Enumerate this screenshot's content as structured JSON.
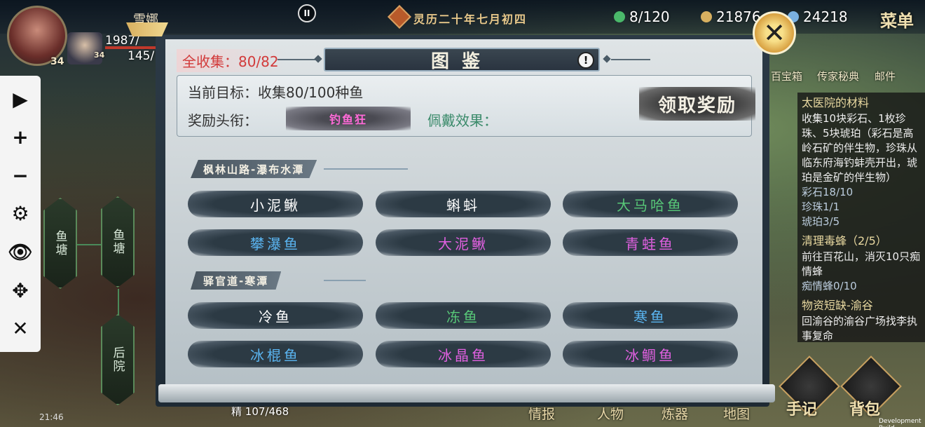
{
  "hud": {
    "player_name": "雪娜",
    "hp_text": "1987/",
    "mp_text": "145/",
    "level_main": "34",
    "level_companion": "34",
    "date": "灵历二十年七月初四",
    "res_1": "8/120",
    "res_2": "21876",
    "res_3": "24218",
    "menu_label": "菜单",
    "pause_glyph": "II",
    "exp_text": "107/468",
    "exp_label": "精",
    "clock": "21:46",
    "dev_build": "Development Build"
  },
  "toolbar": {
    "play": "▶",
    "zoom_in": "+",
    "zoom_out": "−",
    "settings": "⚙",
    "view": "👁",
    "move": "✥",
    "close": "✕"
  },
  "map": {
    "node_1": "鱼塘",
    "node_2": "鱼塘",
    "node_3": "后院"
  },
  "top_icons": {
    "item_1": "百宝箱",
    "item_2": "传家秘典",
    "item_3": "邮件"
  },
  "quests": [
    {
      "title": "太医院的材料",
      "body": "收集10块彩石、1枚珍珠、5块琥珀（彩石是高岭石矿的伴生物，珍珠从临东府海钓蚌壳开出，琥珀是金矿的伴生物）",
      "progress": [
        "彩石18/10",
        "珍珠1/1",
        "琥珀3/5"
      ]
    },
    {
      "title": "清理毒蜂（2/5）",
      "body": "前往百花山，消灭10只痴情蜂",
      "progress": [
        "痴情蜂0/10"
      ]
    },
    {
      "title": "物资短缺-渝谷",
      "body": "回渝谷的渝谷广场找李执事复命",
      "progress": []
    }
  ],
  "bottom_nav": {
    "item_1": "情报",
    "item_2": "人物",
    "item_3": "炼器",
    "item_4": "地图"
  },
  "corner_buttons": {
    "notes": "手记",
    "bag": "背包"
  },
  "modal": {
    "title": "图鉴",
    "info_glyph": "!",
    "collect_total": "全收集：80/82",
    "target": "当前目标：收集80/100种鱼",
    "reward_title_label": "奖励头衔：",
    "reward_title": "钓鱼狂",
    "effect_label": "佩戴效果：",
    "claim": "领取奖励",
    "close_glyph": "✕",
    "sections": [
      {
        "name": "枫林山路-瀑布水潭",
        "fish": [
          {
            "name": "小泥鳅",
            "color": "#ffffff"
          },
          {
            "name": "蝌蚪",
            "color": "#ffffff"
          },
          {
            "name": "大马哈鱼",
            "color": "#58c878"
          },
          {
            "name": "攀瀑鱼",
            "color": "#5ab4f0"
          },
          {
            "name": "大泥鳅",
            "color": "#e060e0"
          },
          {
            "name": "青蛙鱼",
            "color": "#e060e0"
          }
        ]
      },
      {
        "name": "驿官道-寒潭",
        "fish": [
          {
            "name": "冷鱼",
            "color": "#ffffff"
          },
          {
            "name": "冻鱼",
            "color": "#58c878"
          },
          {
            "name": "寒鱼",
            "color": "#5ab4f0"
          },
          {
            "name": "冰棍鱼",
            "color": "#5ab4f0"
          },
          {
            "name": "冰晶鱼",
            "color": "#e060e0"
          },
          {
            "name": "冰鲷鱼",
            "color": "#e060e0"
          }
        ]
      }
    ]
  }
}
